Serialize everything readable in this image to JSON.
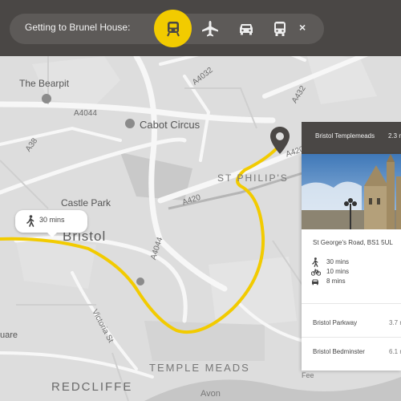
{
  "header": {
    "title": "Getting to Brunel House:",
    "modes": [
      {
        "name": "train",
        "active": true
      },
      {
        "name": "plane",
        "active": false
      },
      {
        "name": "car",
        "active": false
      },
      {
        "name": "bus",
        "active": false
      }
    ],
    "close_label": "×"
  },
  "map": {
    "areas": [
      "The Bearpit",
      "Cabot Circus",
      "St Philip's",
      "Castle Park",
      "Bristol",
      "Temple Meads",
      "Redcliffe",
      "uare",
      "Avon",
      "Fee"
    ],
    "roads": [
      "A4032",
      "A4044",
      "A432",
      "A38",
      "A420",
      "A420",
      "A4044",
      "Victoria St"
    ],
    "route_color": "#f2cb00"
  },
  "walk_callout": {
    "time": "30 mins"
  },
  "destination": {
    "name": "Bristol Templemeads",
    "distance": "2.3 m",
    "address": "St George's Road, BS1 5UL",
    "travel_times": [
      {
        "mode": "walk",
        "time": "30 mins"
      },
      {
        "mode": "bike",
        "time": "10 mins"
      },
      {
        "mode": "car",
        "time": "8 mins"
      }
    ],
    "other_stations": [
      {
        "name": "Bristol Parkway",
        "distance": "3.7 m"
      },
      {
        "name": "Bristol Bedminster",
        "distance": "6.1 m"
      }
    ]
  }
}
